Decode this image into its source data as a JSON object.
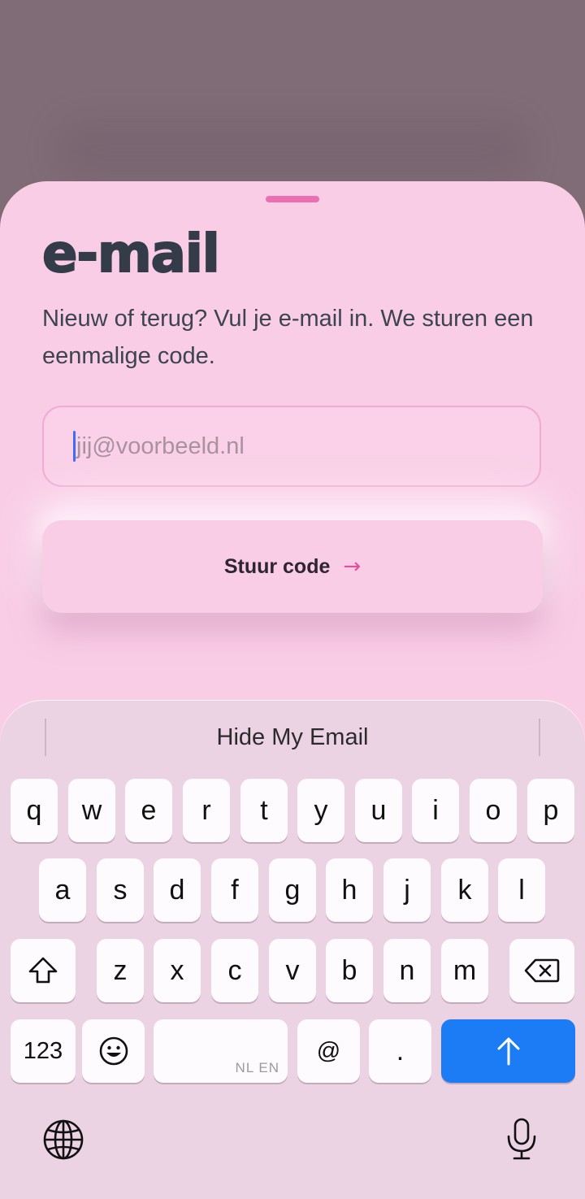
{
  "sheet": {
    "title": "e-mail",
    "description": "Nieuw of terug? Vul je e-mail in. We sturen een eenmalige code.",
    "email_placeholder": "jij@voorbeeld.nl",
    "email_value": "",
    "send_button_label": "Stuur code",
    "send_button_icon": "arrow-right-icon",
    "accent_color": "#ec6fb2",
    "background_color": "#f9cde6"
  },
  "keyboard": {
    "suggestion": "Hide My Email",
    "row1": [
      "q",
      "w",
      "e",
      "r",
      "t",
      "y",
      "u",
      "i",
      "o",
      "p"
    ],
    "row2": [
      "a",
      "s",
      "d",
      "f",
      "g",
      "h",
      "j",
      "k",
      "l"
    ],
    "row3": [
      "z",
      "x",
      "c",
      "v",
      "b",
      "n",
      "m"
    ],
    "numbers_key": "123",
    "at_key": "@",
    "dot_key": ".",
    "space_hint": "NL EN",
    "shift_icon": "shift-icon",
    "delete_icon": "backspace-icon",
    "emoji_icon": "emoji-icon",
    "send_icon": "arrow-up-icon",
    "globe_icon": "globe-icon",
    "mic_icon": "microphone-icon",
    "send_key_color": "#1b7cf5"
  }
}
